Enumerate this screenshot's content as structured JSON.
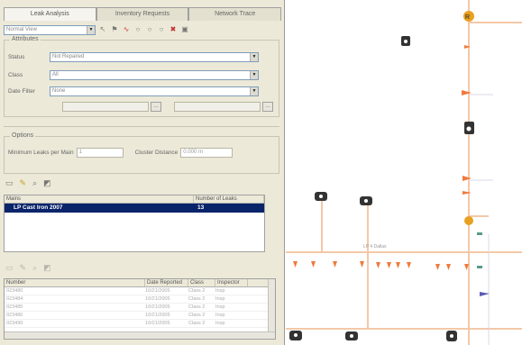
{
  "tabs": [
    "Leak Analysis",
    "Inventory Requests",
    "Network Trace"
  ],
  "toolbar": {
    "view_select": "Normal View"
  },
  "attributes": {
    "title": "Attributes",
    "fields": [
      {
        "label": "Status",
        "value": "Not Repaired"
      },
      {
        "label": "Class",
        "value": "All"
      },
      {
        "label": "Date Filter",
        "value": "None"
      }
    ]
  },
  "options": {
    "title": "Options",
    "min_leaks_label": "Minimum Leaks per Main",
    "min_leaks_value": "1",
    "cluster_label": "Cluster Distance",
    "cluster_value": "0.000 m"
  },
  "mains": {
    "headers": [
      "Mains",
      "Number of Leaks"
    ],
    "selected": {
      "name": "LP Cast Iron 2007",
      "count": "13"
    }
  },
  "reports": {
    "headers": [
      "Number",
      "Date Reported",
      "Class",
      "Inspector"
    ],
    "rows": [
      [
        "023480",
        "10/21/2005",
        "Class 2",
        "Insp"
      ],
      [
        "023484",
        "10/21/2005",
        "Class 2",
        "Insp"
      ],
      [
        "023485",
        "10/21/2005",
        "Class 2",
        "Insp"
      ],
      [
        "023486",
        "10/21/2005",
        "Class 2",
        "Insp"
      ],
      [
        "023490",
        "10/21/2005",
        "Class 2",
        "Insp"
      ]
    ]
  },
  "map": {
    "street_label": "LP 4 Dallas"
  },
  "colors": {
    "leak": "#f07a3c",
    "pipe": "#f4c8a8",
    "selection": "#0a246a",
    "panel": "#ece9d8"
  }
}
